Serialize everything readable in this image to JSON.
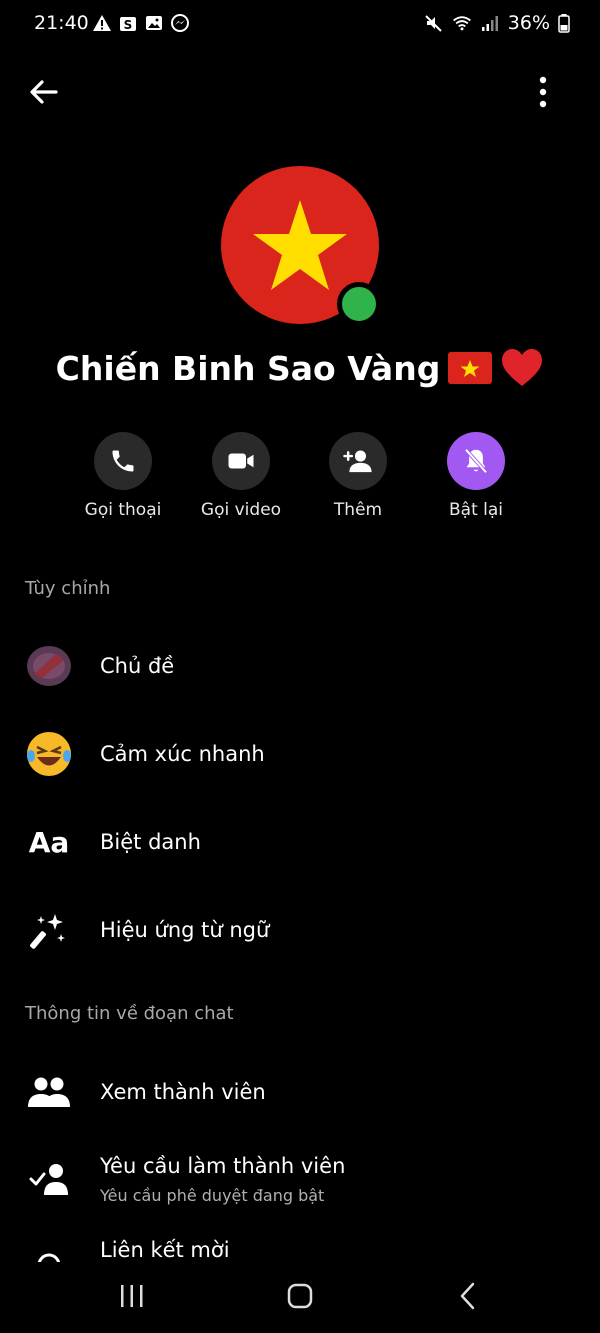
{
  "status_bar": {
    "time": "21:40",
    "battery": "36%",
    "icons_left": [
      "warning-icon",
      "s-app-icon",
      "gallery-icon",
      "messenger-icon"
    ],
    "icons_right": [
      "mute-icon",
      "wifi-icon",
      "signal-icon",
      "battery-icon"
    ]
  },
  "app_bar": {
    "back_icon": "arrow-left-icon",
    "more_icon": "more-vertical-icon"
  },
  "profile": {
    "name": "Chiến Binh Sao Vàng",
    "online": true,
    "avatar_colors": {
      "background": "#da251d",
      "star": "#ffde00"
    },
    "status_color": "#2fb34a"
  },
  "actions": [
    {
      "label": "Gọi thoại",
      "icon": "phone-icon"
    },
    {
      "label": "Gọi video",
      "icon": "video-icon"
    },
    {
      "label": "Thêm",
      "icon": "add-person-icon"
    },
    {
      "label": "Bật lại",
      "icon": "bell-off-icon",
      "accent": "#a259f2"
    }
  ],
  "sections": {
    "customize": {
      "title": "Tùy chỉnh",
      "items": [
        {
          "label": "Chủ đề",
          "icon": "theme-icon"
        },
        {
          "label": "Cảm xúc nhanh",
          "icon": "laughing-emoji-icon"
        },
        {
          "label": "Biệt danh",
          "icon": "text-aa-icon",
          "icon_text": "Aa"
        },
        {
          "label": "Hiệu ứng từ ngữ",
          "icon": "magic-wand-icon"
        }
      ]
    },
    "chat_info": {
      "title": "Thông tin về đoạn chat",
      "items": [
        {
          "label": "Xem thành viên",
          "icon": "group-icon"
        },
        {
          "label": "Yêu cầu làm thành viên",
          "sublabel": "Yêu cầu phê duyệt đang bật",
          "icon": "member-request-icon"
        },
        {
          "label": "Liên kết mời",
          "icon": "link-icon"
        }
      ]
    }
  },
  "nav_bar": {
    "buttons": [
      "recent-apps-icon",
      "home-icon",
      "back-icon"
    ]
  }
}
